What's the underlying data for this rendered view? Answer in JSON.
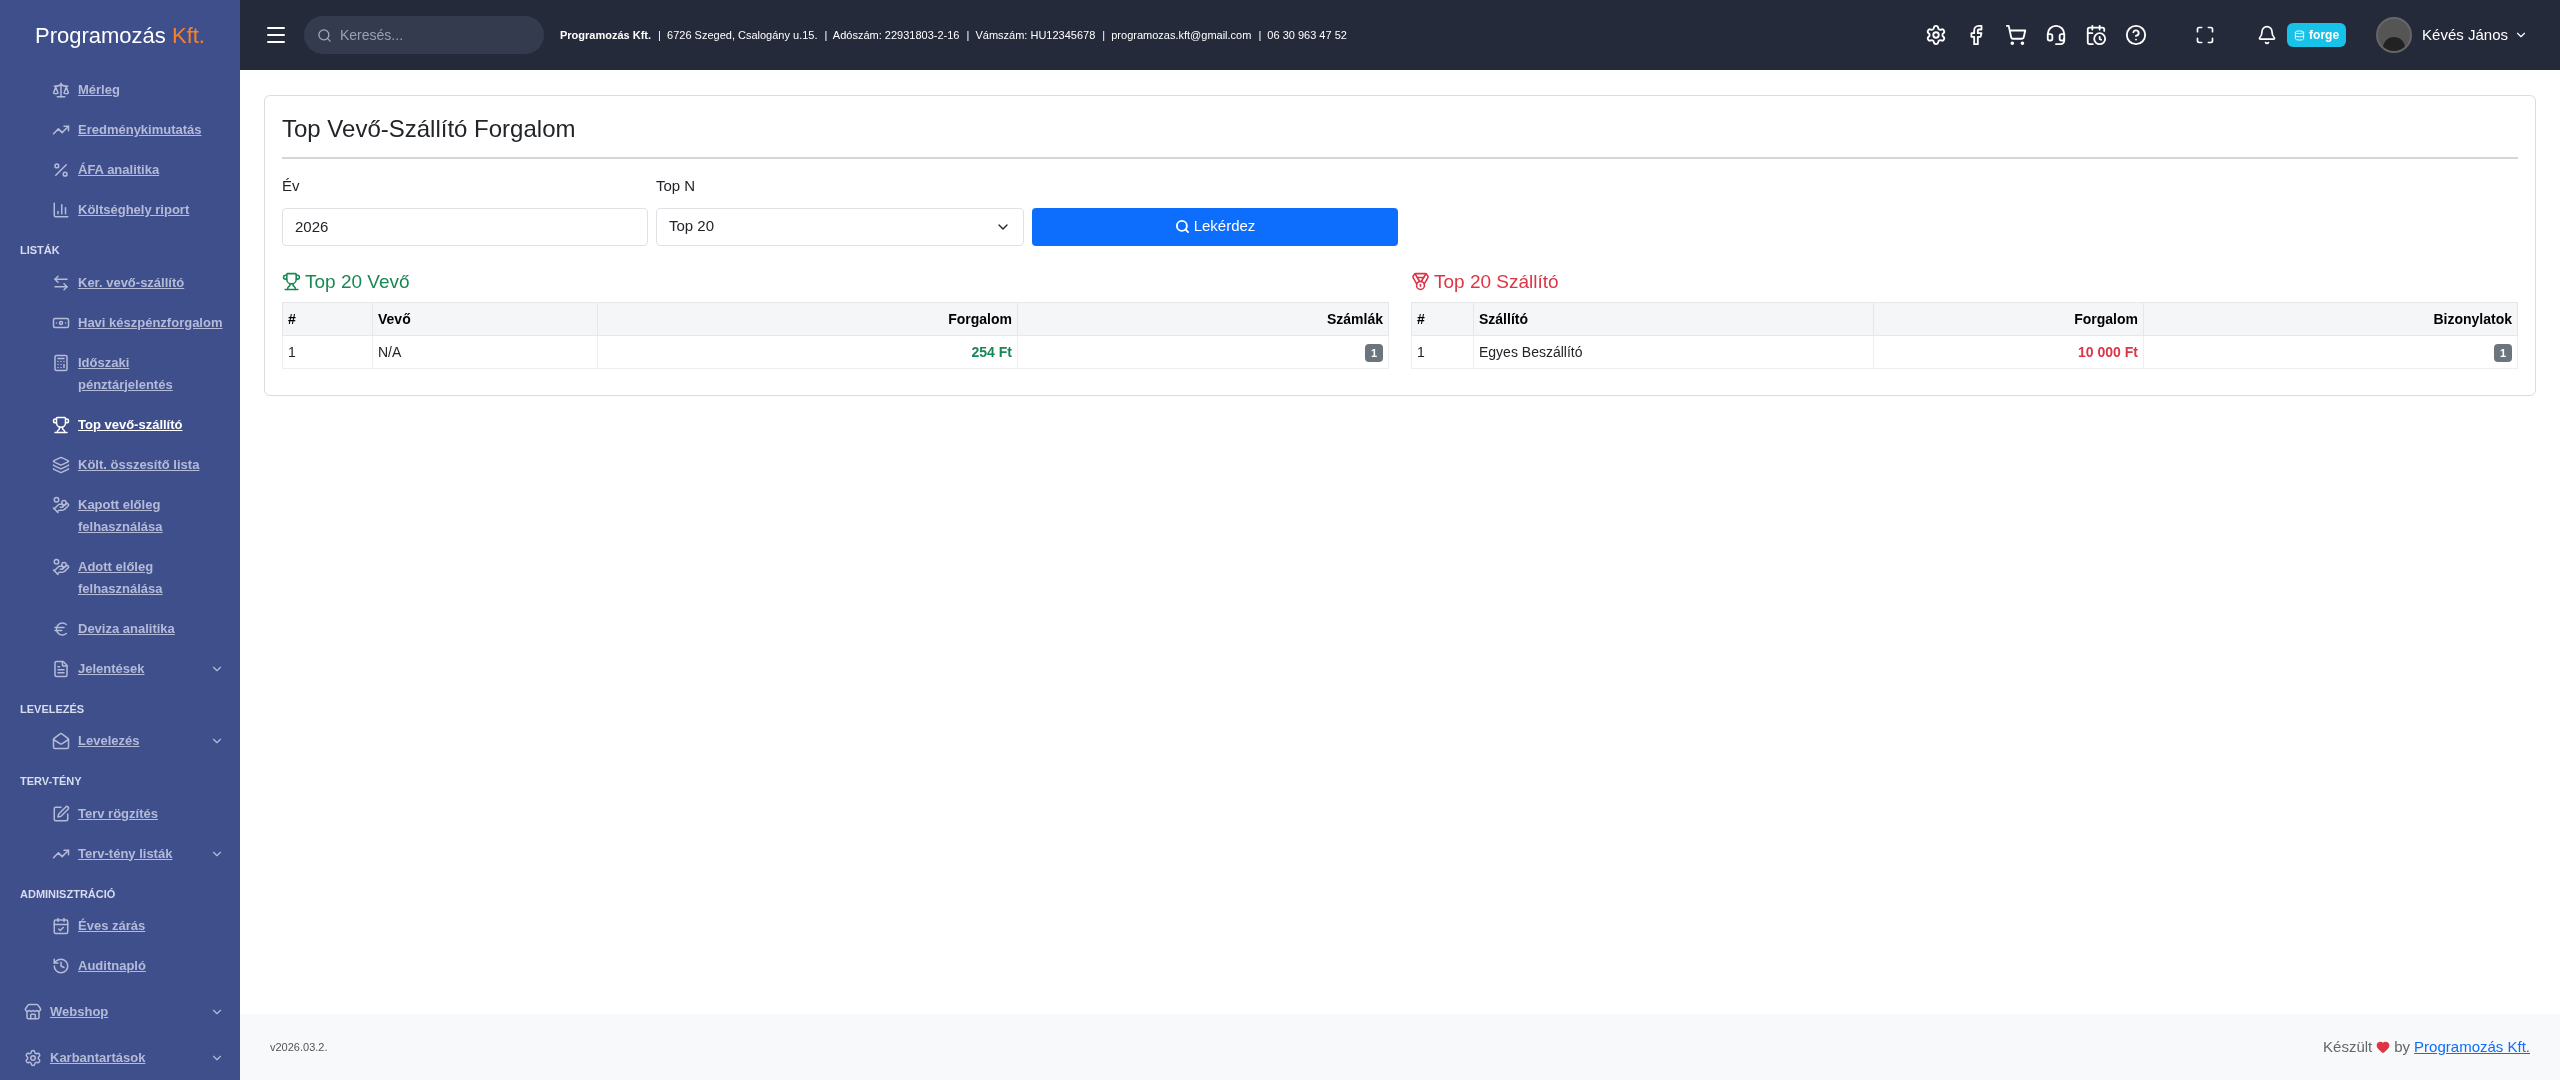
{
  "brand": {
    "name": "Programozás",
    "suffix": "Kft."
  },
  "sidebar": {
    "groups": [
      {
        "items": [
          {
            "label": "Mérleg",
            "selected": false,
            "expandable": false
          },
          {
            "label": "Eredménykimutatás",
            "selected": false,
            "expandable": false
          },
          {
            "label": "ÁFA analitika",
            "selected": false,
            "expandable": false
          },
          {
            "label": "Költséghely riport",
            "selected": false,
            "expandable": false
          }
        ]
      },
      {
        "heading": "LISTÁK",
        "items": [
          {
            "label": "Ker. vevő-szállító",
            "selected": false,
            "expandable": false
          },
          {
            "label": "Havi készpénzforgalom",
            "selected": false,
            "expandable": false
          },
          {
            "label": "Időszaki pénztárjelentés",
            "selected": false,
            "expandable": false
          },
          {
            "label": "Top vevő-szállító",
            "selected": true,
            "expandable": false
          },
          {
            "label": "Költ. összesítő lista",
            "selected": false,
            "expandable": false
          },
          {
            "label": "Kapott előleg felhasználása",
            "selected": false,
            "expandable": false
          },
          {
            "label": "Adott előleg felhasználása",
            "selected": false,
            "expandable": false
          },
          {
            "label": "Deviza analitika",
            "selected": false,
            "expandable": false
          },
          {
            "label": "Jelentések",
            "selected": false,
            "expandable": true
          }
        ]
      },
      {
        "heading": "LEVELEZÉS",
        "items": [
          {
            "label": "Levelezés",
            "selected": false,
            "expandable": true
          }
        ]
      },
      {
        "heading": "TERV-TÉNY",
        "items": [
          {
            "label": "Terv rögzítés",
            "selected": false,
            "expandable": false
          },
          {
            "label": "Terv-tény listák",
            "selected": false,
            "expandable": true
          }
        ]
      },
      {
        "heading": "ADMINISZTRÁCIÓ",
        "items": [
          {
            "label": "Éves zárás",
            "selected": false,
            "expandable": false
          },
          {
            "label": "Auditnapló",
            "selected": false,
            "expandable": false
          }
        ]
      }
    ],
    "top_items": [
      {
        "label": "Webshop",
        "selected": false,
        "expandable": true
      },
      {
        "label": "Karbantartások",
        "selected": false,
        "expandable": true
      }
    ]
  },
  "topbar": {
    "search": {
      "placeholder": "Keresés..."
    },
    "company_info": [
      "Programozás Kft.",
      "|  6726 Szeged, Csalogány u.15.",
      "|  Adószám: 22931803-2-16",
      "|  Vámszám: HU12345678",
      "|  programozas.kft@gmail.com",
      "|  06 30 963 47 52"
    ],
    "badge": "forge",
    "user": "Kévés János"
  },
  "page": {
    "title": "Top Vevő-Szállító Forgalom",
    "year": {
      "label": "Év",
      "value": "2026"
    },
    "top_n": {
      "label": "Top N",
      "value": "Top 20"
    },
    "query_button": "Lekérdez",
    "tables": [
      {
        "title": "Top 20 Vevő",
        "color": "#198754",
        "columns": [
          "#",
          "Vevő",
          "Forgalom",
          "Számlák"
        ],
        "rows": [
          [
            "1",
            "N/A",
            "254 Ft",
            "1"
          ]
        ]
      },
      {
        "title": "Top 20 Szállító",
        "color": "#dc3545",
        "columns": [
          "#",
          "Szállító",
          "Forgalom",
          "Bizonylatok"
        ],
        "rows": [
          [
            "1",
            "Egyes Beszállító",
            "10 000 Ft",
            "1"
          ]
        ]
      }
    ]
  },
  "footer": {
    "version": "v2026.03.2.",
    "made": "Készült",
    "by": "by",
    "link": "Programozás Kft."
  }
}
